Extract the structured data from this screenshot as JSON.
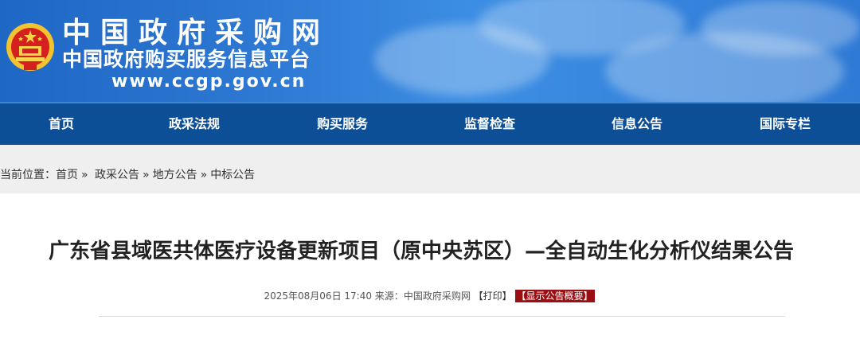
{
  "header": {
    "site_name": "中国政府采购网",
    "site_subtitle": "中国政府购买服务信息平台",
    "site_url": "www.ccgp.gov.cn",
    "emblem_icon": "national-emblem-icon"
  },
  "nav": {
    "items": [
      {
        "label": "首页"
      },
      {
        "label": "政采法规"
      },
      {
        "label": "购买服务"
      },
      {
        "label": "监督检查"
      },
      {
        "label": "信息公告"
      },
      {
        "label": "国际专栏"
      }
    ]
  },
  "breadcrumb": {
    "prefix": "当前位置：",
    "items": [
      "首页",
      "政采公告",
      "地方公告",
      "中标公告"
    ],
    "separator": "»"
  },
  "article": {
    "title": "广东省县域医共体医疗设备更新项目（原中央苏区）—全自动生化分析仪结果公告",
    "datetime": "2025年08月06日 17:40",
    "source_label": "来源：",
    "source": "中国政府采购网",
    "print_label": "【打印】",
    "summary_label": "【显示公告概要】"
  },
  "colors": {
    "header_blue": "#2d78d3",
    "nav_blue": "#0c4f97",
    "summary_red": "#9b0f14"
  }
}
